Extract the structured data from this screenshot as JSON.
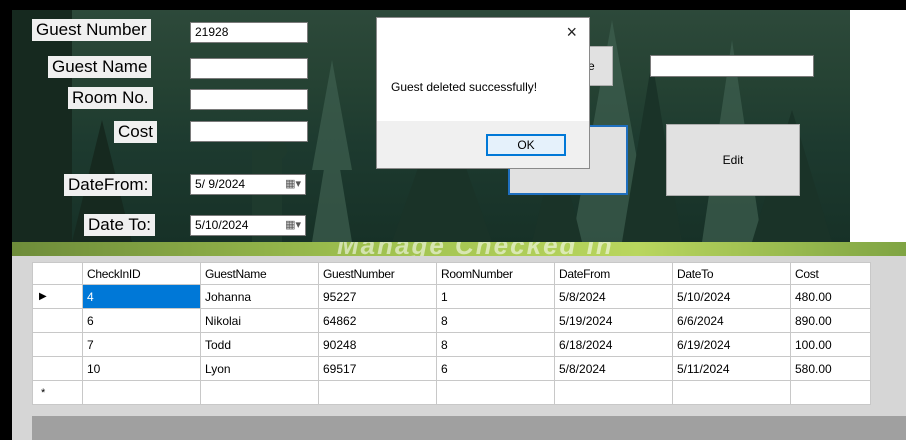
{
  "form": {
    "labels": {
      "guest_number": "Guest Number",
      "guest_name": "Guest Name",
      "room_no": "Room No.",
      "cost": "Cost",
      "date_from": "DateFrom:",
      "date_to": "Date To:"
    },
    "values": {
      "guest_number": "21928",
      "guest_name": "",
      "room_no": "",
      "cost": "",
      "date_from": "5/ 9/2024",
      "date_to": "5/10/2024",
      "search": ""
    },
    "buttons": {
      "hidden_label_fragment": "e",
      "edit": "Edit"
    }
  },
  "dialog": {
    "message": "Guest deleted successfully!",
    "ok": "OK",
    "close": "×"
  },
  "banner": {
    "text": "Manage Checked In"
  },
  "grid": {
    "columns": [
      "CheckInID",
      "GuestName",
      "GuestNumber",
      "RoomNumber",
      "DateFrom",
      "DateTo",
      "Cost"
    ],
    "rows": [
      [
        "4",
        "Johanna",
        "95227",
        "1",
        "5/8/2024",
        "5/10/2024",
        "480.00"
      ],
      [
        "6",
        "Nikolai",
        "64862",
        "8",
        "5/19/2024",
        "6/6/2024",
        "890.00"
      ],
      [
        "7",
        "Todd",
        "90248",
        "8",
        "6/18/2024",
        "6/19/2024",
        "100.00"
      ],
      [
        "10",
        "Lyon",
        "69517",
        "6",
        "5/8/2024",
        "5/11/2024",
        "580.00"
      ]
    ],
    "current_row_marker": "▶",
    "new_row_marker": "*"
  }
}
